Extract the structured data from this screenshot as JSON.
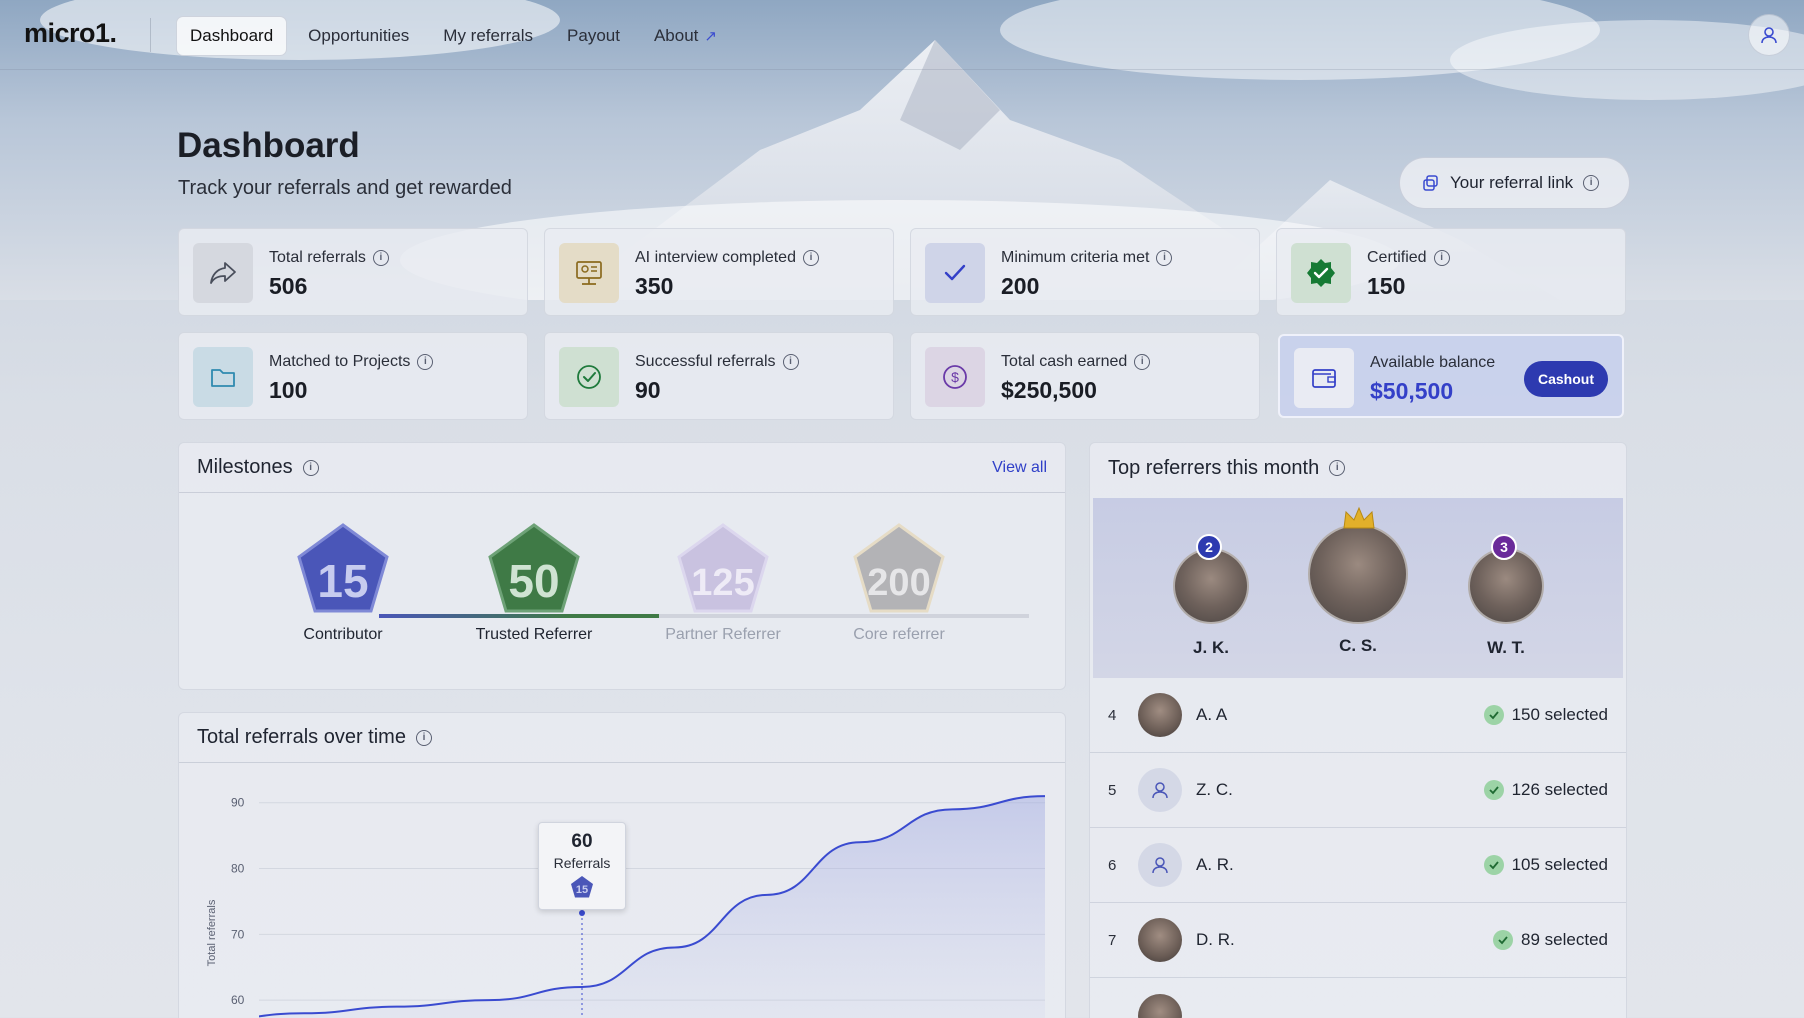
{
  "app": {
    "logo": "micro1."
  },
  "nav": {
    "items": [
      {
        "label": "Dashboard",
        "active": true
      },
      {
        "label": "Opportunities"
      },
      {
        "label": "My referrals"
      },
      {
        "label": "Payout"
      },
      {
        "label": "About"
      }
    ]
  },
  "header": {
    "title": "Dashboard",
    "subtitle": "Track your referrals and get rewarded",
    "referral_link_label": "Your referral link"
  },
  "stats": [
    {
      "label": "Total referrals",
      "value": "506",
      "icon": "share-arrow-icon"
    },
    {
      "label": "AI interview completed",
      "value": "350",
      "icon": "interview-icon"
    },
    {
      "label": "Minimum criteria met",
      "value": "200",
      "icon": "check-icon"
    },
    {
      "label": "Certified",
      "value": "150",
      "icon": "certified-seal-icon"
    },
    {
      "label": "Matched to Projects",
      "value": "100",
      "icon": "folder-icon"
    },
    {
      "label": "Successful referrals",
      "value": "90",
      "icon": "check-circle-icon"
    },
    {
      "label": "Total cash earned",
      "value": "$250,500",
      "icon": "dollar-icon"
    },
    {
      "label": "Available balance",
      "value": "$50,500",
      "icon": "wallet-icon"
    }
  ],
  "cashout_label": "Cashout",
  "milestones": {
    "title": "Milestones",
    "view_all": "View all",
    "items": [
      {
        "number": "15",
        "name": "Contributor",
        "achieved": true,
        "color": "#4a56b8"
      },
      {
        "number": "50",
        "name": "Trusted Referrer",
        "achieved": true,
        "color": "#3f7a46"
      },
      {
        "number": "125",
        "name": "Partner Referrer",
        "achieved": false,
        "color": "#b8b1d6"
      },
      {
        "number": "200",
        "name": "Core referrer",
        "achieved": false,
        "color": "#a8a8ac"
      }
    ]
  },
  "chart": {
    "title": "Total referrals over time",
    "tooltip": {
      "value": "60",
      "label": "Referrals",
      "badge": "15"
    }
  },
  "chart_data": {
    "type": "area",
    "ylabel": "Total referrals",
    "xlabel": "",
    "y_ticks": [
      60,
      70,
      80,
      90
    ],
    "ylim": [
      55,
      93
    ],
    "x": [
      0,
      1,
      2,
      3,
      4,
      5,
      6,
      7,
      8,
      9,
      10
    ],
    "series": [
      {
        "values": [
          56,
          57,
          58,
          59,
          60,
          62,
          68,
          76,
          84,
          89,
          91
        ]
      }
    ],
    "highlight_point": {
      "x": 5,
      "y": 60
    }
  },
  "top_referrers": {
    "title": "Top referrers this month",
    "podium": [
      {
        "rank": "2",
        "name": "J. K."
      },
      {
        "rank": "1",
        "name": "C. S."
      },
      {
        "rank": "3",
        "name": "W. T."
      }
    ],
    "list": [
      {
        "rank": "4",
        "name": "A. A",
        "selected": "150 selected",
        "avatar": "photo"
      },
      {
        "rank": "5",
        "name": "Z. C.",
        "selected": "126 selected",
        "avatar": "placeholder"
      },
      {
        "rank": "6",
        "name": "A. R.",
        "selected": "105 selected",
        "avatar": "placeholder"
      },
      {
        "rank": "7",
        "name": "D. R.",
        "selected": "89 selected",
        "avatar": "photo"
      }
    ]
  }
}
